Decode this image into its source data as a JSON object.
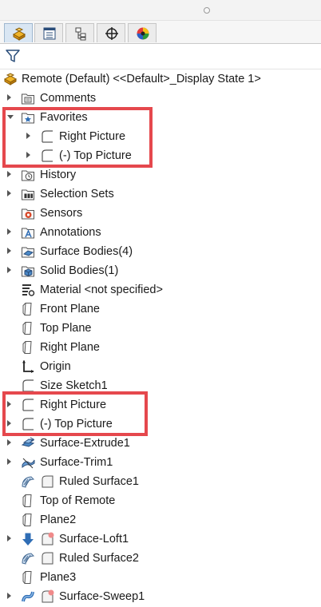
{
  "tabs": [
    {
      "icon": "feature-manager-icon",
      "active": true
    },
    {
      "icon": "property-manager-icon",
      "active": false
    },
    {
      "icon": "configuration-manager-icon",
      "active": false
    },
    {
      "icon": "dimxpert-icon",
      "active": false
    },
    {
      "icon": "display-manager-icon",
      "active": false
    }
  ],
  "filter": {
    "icon": "filter-icon"
  },
  "tree": {
    "root": {
      "label": "Remote (Default) <<Default>_Display State 1>",
      "icon": "part-icon"
    },
    "items": [
      {
        "label": "Comments",
        "icon": "comments-folder-icon",
        "caret": "right"
      },
      {
        "label": "Favorites",
        "icon": "favorites-folder-icon",
        "caret": "down"
      },
      {
        "label": "Right Picture",
        "icon": "sketch-icon",
        "caret": "right"
      },
      {
        "label": "(-) Top Picture",
        "icon": "sketch-icon",
        "caret": "right"
      },
      {
        "label": "History",
        "icon": "history-folder-icon",
        "caret": "right"
      },
      {
        "label": "Selection Sets",
        "icon": "selection-sets-folder-icon",
        "caret": "right"
      },
      {
        "label": "Sensors",
        "icon": "sensors-folder-icon",
        "caret": ""
      },
      {
        "label": "Annotations",
        "icon": "annotations-folder-icon",
        "caret": "right"
      },
      {
        "label": "Surface Bodies(4)",
        "icon": "surface-bodies-folder-icon",
        "caret": "right"
      },
      {
        "label": "Solid Bodies(1)",
        "icon": "solid-bodies-folder-icon",
        "caret": "right"
      },
      {
        "label": "Material <not specified>",
        "icon": "material-icon",
        "caret": ""
      },
      {
        "label": "Front Plane",
        "icon": "plane-icon",
        "caret": ""
      },
      {
        "label": "Top Plane",
        "icon": "plane-icon",
        "caret": ""
      },
      {
        "label": "Right Plane",
        "icon": "plane-icon",
        "caret": ""
      },
      {
        "label": "Origin",
        "icon": "origin-icon",
        "caret": ""
      },
      {
        "label": "Size Sketch1",
        "icon": "sketch-icon",
        "caret": ""
      },
      {
        "label": "Right Picture",
        "icon": "sketch-icon",
        "caret": "right"
      },
      {
        "label": "(-) Top Picture",
        "icon": "sketch-icon",
        "caret": "right"
      },
      {
        "label": "Surface-Extrude1",
        "icon": "surface-extrude-icon",
        "caret": "right"
      },
      {
        "label": "Surface-Trim1",
        "icon": "surface-trim-icon",
        "caret": "right"
      },
      {
        "label": "Ruled Surface1",
        "icon": "ruled-surface-icon",
        "caret": ""
      },
      {
        "label": "Top of Remote",
        "icon": "plane-icon",
        "caret": ""
      },
      {
        "label": "Plane2",
        "icon": "plane-icon",
        "caret": ""
      },
      {
        "label": "Surface-Loft1",
        "icon": "surface-loft-icon",
        "caret": "right"
      },
      {
        "label": "Ruled Surface2",
        "icon": "ruled-surface-icon",
        "caret": ""
      },
      {
        "label": "Plane3",
        "icon": "plane-icon",
        "caret": ""
      },
      {
        "label": "Surface-Sweep1",
        "icon": "surface-sweep-icon",
        "caret": "right"
      }
    ]
  },
  "colors": {
    "highlight": "#e5484d",
    "accent_blue": "#2f6db5"
  }
}
